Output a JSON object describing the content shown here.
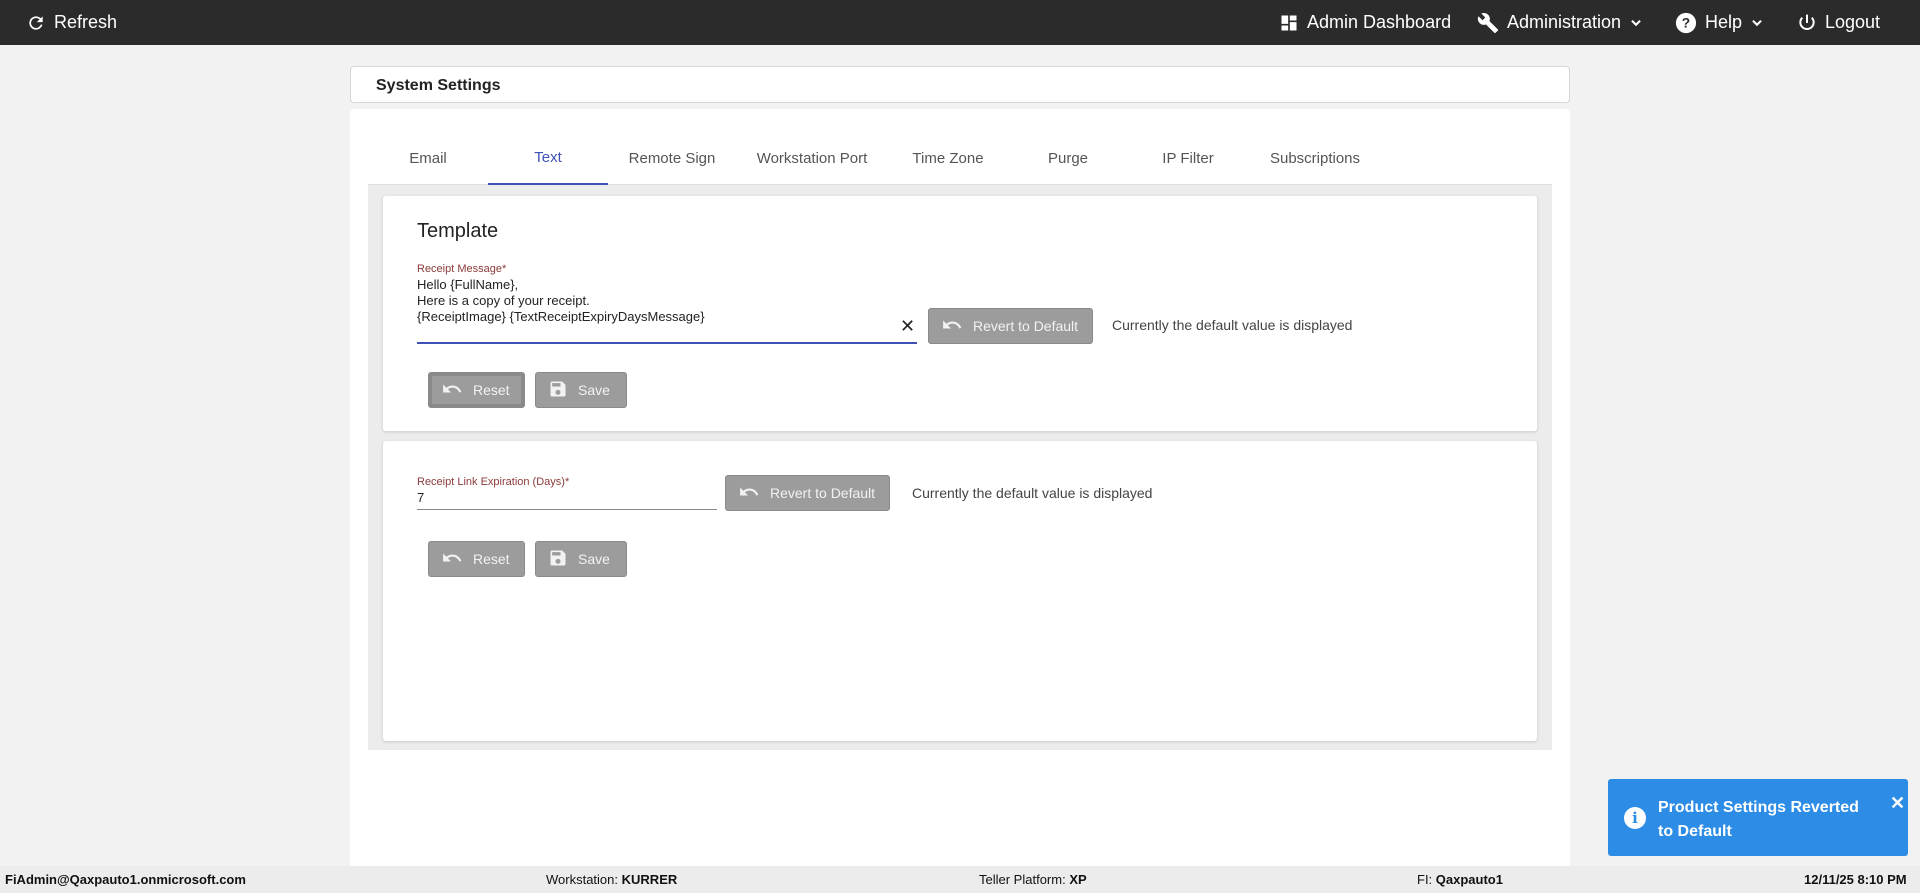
{
  "topbar": {
    "refresh_label": "Refresh",
    "admin_dashboard_label": "Admin Dashboard",
    "administration_label": "Administration",
    "help_label": "Help",
    "logout_label": "Logout"
  },
  "page": {
    "title": "System Settings"
  },
  "tabs": [
    {
      "label": "Email"
    },
    {
      "label": "Text"
    },
    {
      "label": "Remote Sign"
    },
    {
      "label": "Workstation Port"
    },
    {
      "label": "Time Zone"
    },
    {
      "label": "Purge"
    },
    {
      "label": "IP Filter"
    },
    {
      "label": "Subscriptions"
    }
  ],
  "active_tab": "Text",
  "template_card": {
    "title": "Template",
    "field_label": "Receipt Message*",
    "field_value_lines": [
      "Hello {FullName},",
      "Here is a copy of your receipt.",
      "{ReceiptImage} {TextReceiptExpiryDaysMessage}"
    ],
    "revert_label": "Revert to Default",
    "hint": "Currently the default value is displayed",
    "reset_label": "Reset",
    "save_label": "Save"
  },
  "expiration_card": {
    "field_label": "Receipt Link Expiration (Days)*",
    "field_value": "7",
    "revert_label": "Revert to Default",
    "hint": "Currently the default value is displayed",
    "reset_label": "Reset",
    "save_label": "Save"
  },
  "toast": {
    "message": "Product Settings Reverted to Default",
    "color": "#2d8de6"
  },
  "footer": {
    "user": "FiAdmin@Qaxpauto1.onmicrosoft.com",
    "workstation_label": "Workstation:",
    "workstation_value": "KURRER",
    "platform_label": "Teller Platform:",
    "platform_value": "XP",
    "fi_label": "FI:",
    "fi_value": "Qaxpauto1",
    "datetime": "12/11/25 8:10 PM"
  },
  "colors": {
    "topbar": "#2b2b2b",
    "accent": "#3f51b5",
    "button": "#9c9c9c"
  }
}
